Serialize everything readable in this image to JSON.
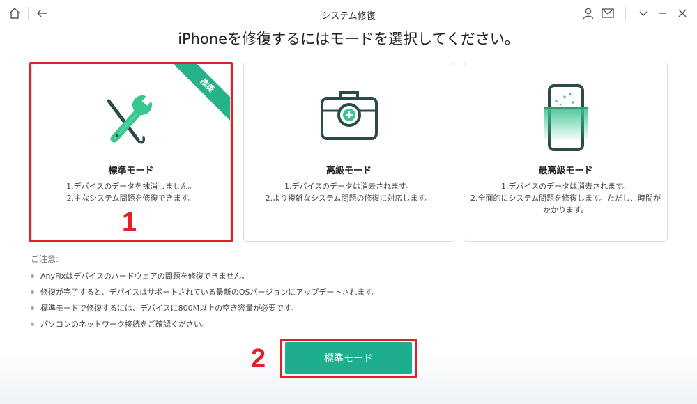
{
  "window": {
    "title": "システム修復"
  },
  "heading": "iPhoneを修復するにはモードを選択してください。",
  "modes": [
    {
      "title": "標準モード",
      "desc": [
        "1.デバイスのデータを抹消しません。",
        "2.主なシステム問題を修復できます。"
      ],
      "badge": "推奨",
      "icon": "wrench-screwdriver-icon"
    },
    {
      "title": "高級モード",
      "desc": [
        "1.デバイスのデータは消去されます。",
        "2.より複雑なシステム問題の修復に対応します。"
      ],
      "icon": "toolbox-icon"
    },
    {
      "title": "最高級モード",
      "desc": [
        "1.デバイスのデータは消去されます。",
        "2.全面的にシステム問題を修復します。ただし、時間が",
        "かかります。"
      ],
      "icon": "phone-scan-icon"
    }
  ],
  "notes": {
    "title": "ご注意:",
    "items": [
      "AnyFixはデバイスのハードウェアの問題を修復できません。",
      "修復が完了すると、デバイスはサポートされている最新のOSバージョンにアップデートされます。",
      "標準モードで修復するには、デバイスに800M以上の空き容量が必要です。",
      "パソコンのネットワーク接続をご確認ください。"
    ]
  },
  "primary_button": "標準モード",
  "annotations": {
    "step1": "1",
    "step2": "2"
  },
  "colors": {
    "accent": "#1fae8d",
    "highlight": "#e3202a",
    "dark": "#2d4a4a"
  }
}
